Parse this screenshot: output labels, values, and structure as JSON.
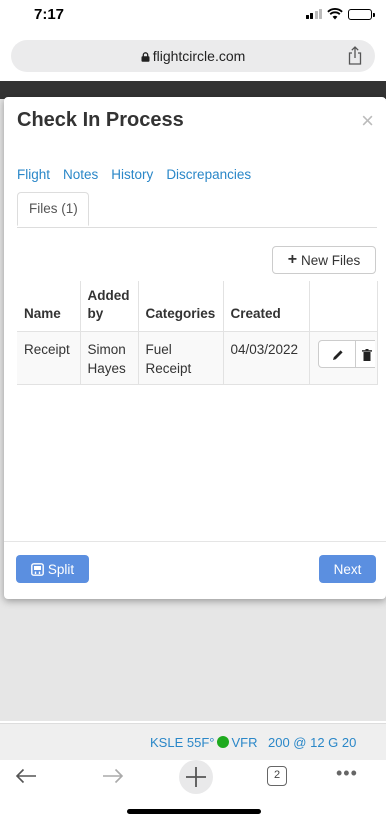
{
  "status_bar": {
    "time": "7:17"
  },
  "browser": {
    "url": "flightcircle.com"
  },
  "modal": {
    "title": "Check In Process",
    "close_symbol": "×",
    "tabs": [
      "Flight",
      "Notes",
      "History",
      "Discrepancies"
    ],
    "active_tab": "Files (1)",
    "new_files_label": "New Files",
    "table": {
      "headers": [
        "Name",
        "Added by",
        "Categories",
        "Created"
      ],
      "rows": [
        {
          "name": "Receipt",
          "added_by": "Simon Hayes",
          "categories": "Fuel Receipt",
          "created": "04/03/2022"
        }
      ]
    },
    "split_label": "Split",
    "next_label": "Next"
  },
  "weather": {
    "station": "KSLE 55F°",
    "flight_rules": "VFR",
    "wind": "200 @ 12 G 20",
    "vfr_color": "#1eaa1e"
  },
  "browser_bar": {
    "tab_count": "2"
  },
  "colors": {
    "link": "#2a87c8",
    "primary_button": "#5b8fe0"
  },
  "icons": [
    "signal-icon",
    "wifi-icon",
    "battery-icon",
    "lock-icon",
    "share-icon",
    "close-icon",
    "plus-icon",
    "pencil-icon",
    "trash-icon",
    "split-icon",
    "back-icon",
    "forward-icon",
    "new-tab-icon",
    "tabs-icon",
    "more-icon"
  ]
}
